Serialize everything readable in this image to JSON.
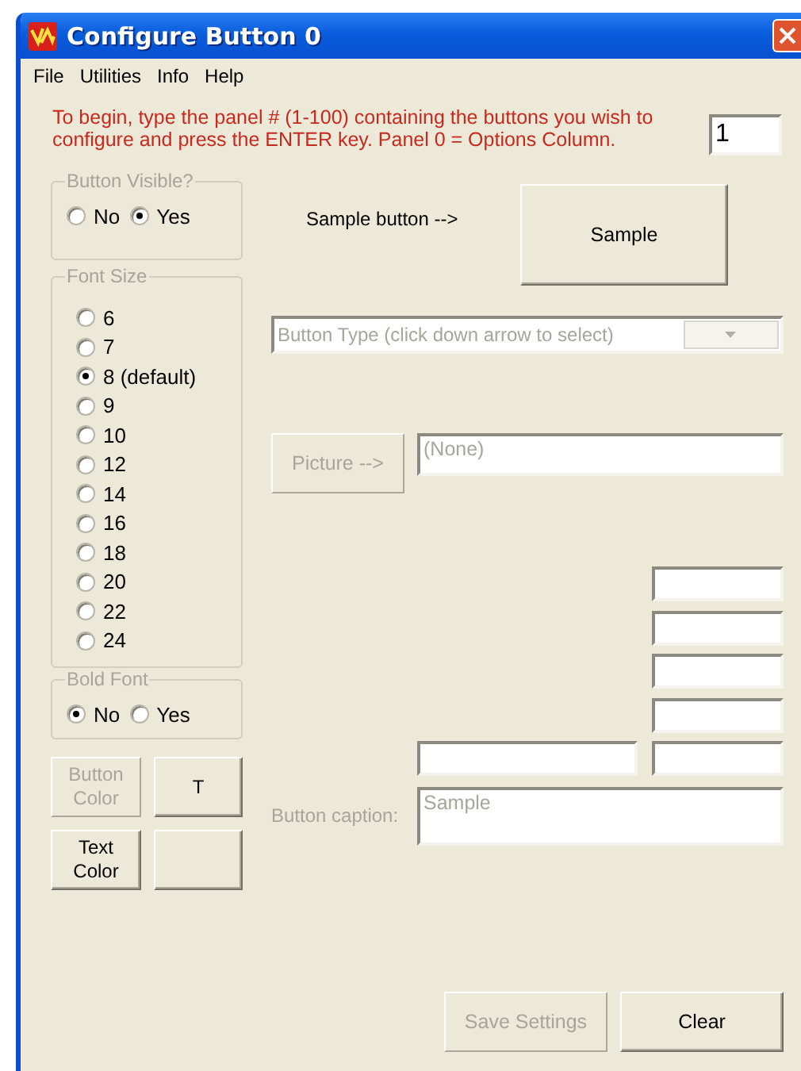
{
  "window": {
    "title": "Configure Button 0"
  },
  "menu": [
    {
      "label": "File"
    },
    {
      "label": "Utilities"
    },
    {
      "label": "Info"
    },
    {
      "label": "Help"
    }
  ],
  "instructions": "To begin, type the panel # (1-100) containing the buttons you wish to configure and press the ENTER key. Panel 0 = Options Column.",
  "panel_field": {
    "value": "1"
  },
  "button_visible": {
    "title": "Button Visible?",
    "options": [
      {
        "label": "No",
        "selected": false
      },
      {
        "label": "Yes",
        "selected": true
      }
    ]
  },
  "font_size": {
    "title": "Font Size",
    "options": [
      {
        "label": "6",
        "selected": false
      },
      {
        "label": "7",
        "selected": false
      },
      {
        "label": "8 (default)",
        "selected": true
      },
      {
        "label": "9",
        "selected": false
      },
      {
        "label": "10",
        "selected": false
      },
      {
        "label": "12",
        "selected": false
      },
      {
        "label": "14",
        "selected": false
      },
      {
        "label": "16",
        "selected": false
      },
      {
        "label": "18",
        "selected": false
      },
      {
        "label": "20",
        "selected": false
      },
      {
        "label": "22",
        "selected": false
      },
      {
        "label": "24",
        "selected": false
      }
    ]
  },
  "bold_font": {
    "title": "Bold Font",
    "options": [
      {
        "label": "No",
        "selected": true
      },
      {
        "label": "Yes",
        "selected": false
      }
    ]
  },
  "color_buttons": [
    {
      "label": "Button Color",
      "disabled": true
    },
    {
      "label": "T",
      "disabled": false
    },
    {
      "label": "Text Color",
      "disabled": false
    },
    {
      "disabled": false
    }
  ],
  "sample": {
    "label": "Sample button -->",
    "button": "Sample"
  },
  "button_type": {
    "value": "Button Type (click down arrow to select)",
    "disabled": true
  },
  "picture": {
    "button": "Picture -->",
    "disabled": true,
    "value": "(None)"
  },
  "caption": {
    "label": "Button caption:",
    "value": "Sample",
    "disabled": true
  },
  "actions": [
    {
      "label": "Save Settings",
      "disabled": true
    },
    {
      "label": "Clear",
      "disabled": false
    }
  ]
}
